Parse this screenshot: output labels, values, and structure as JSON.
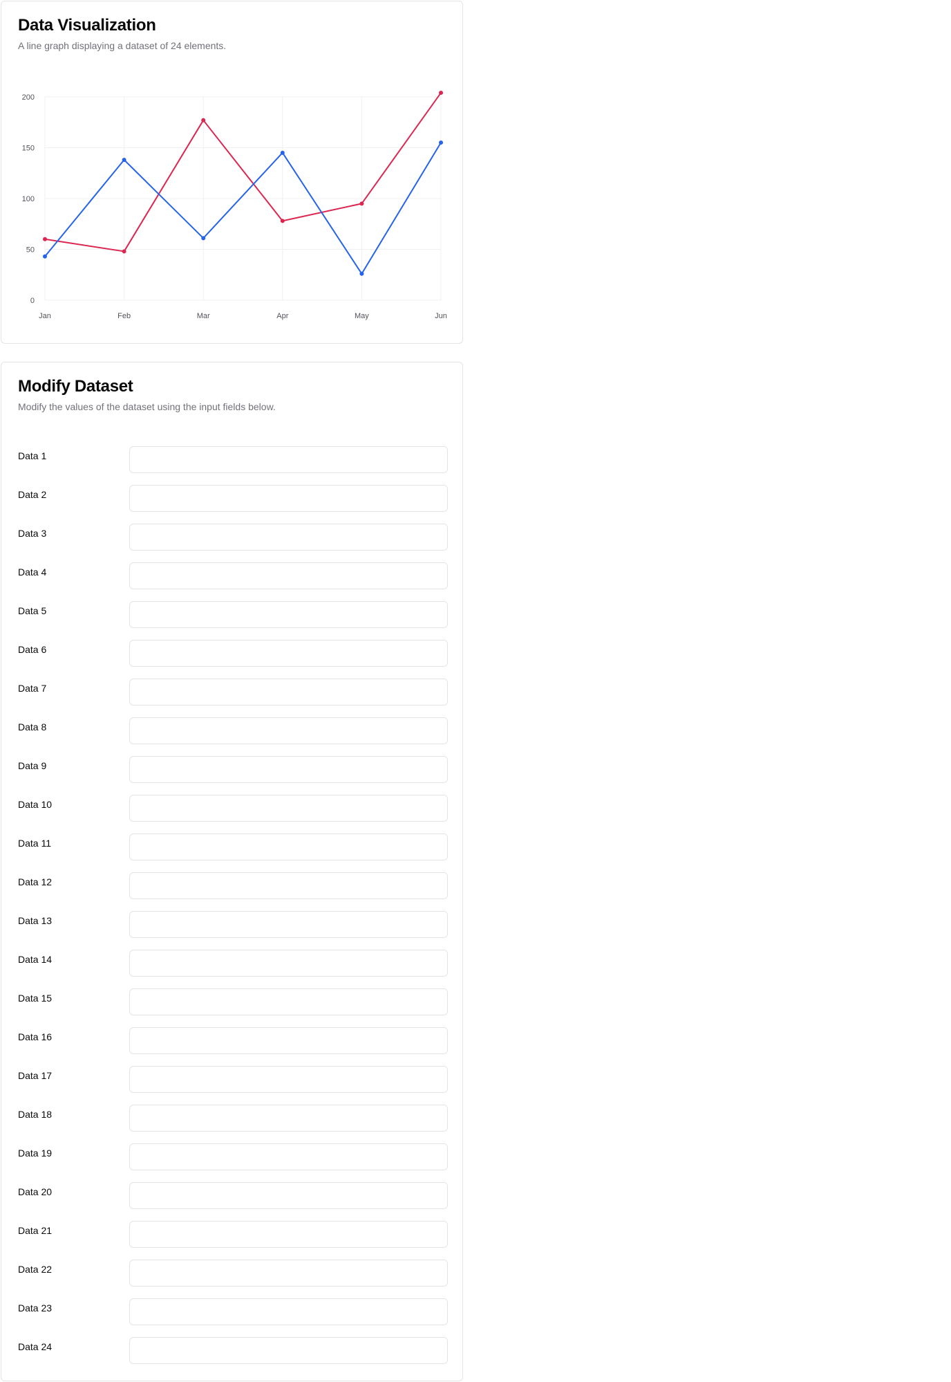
{
  "chart_section": {
    "title": "Data Visualization",
    "description": "A line graph displaying a dataset of 24 elements."
  },
  "form_section": {
    "title": "Modify Dataset",
    "description": "Modify the values of the dataset using the input fields below."
  },
  "fields": [
    {
      "label": "Data 1",
      "value": ""
    },
    {
      "label": "Data 2",
      "value": ""
    },
    {
      "label": "Data 3",
      "value": ""
    },
    {
      "label": "Data 4",
      "value": ""
    },
    {
      "label": "Data 5",
      "value": ""
    },
    {
      "label": "Data 6",
      "value": ""
    },
    {
      "label": "Data 7",
      "value": ""
    },
    {
      "label": "Data 8",
      "value": ""
    },
    {
      "label": "Data 9",
      "value": ""
    },
    {
      "label": "Data 10",
      "value": ""
    },
    {
      "label": "Data 11",
      "value": ""
    },
    {
      "label": "Data 12",
      "value": ""
    },
    {
      "label": "Data 13",
      "value": ""
    },
    {
      "label": "Data 14",
      "value": ""
    },
    {
      "label": "Data 15",
      "value": ""
    },
    {
      "label": "Data 16",
      "value": ""
    },
    {
      "label": "Data 17",
      "value": ""
    },
    {
      "label": "Data 18",
      "value": ""
    },
    {
      "label": "Data 19",
      "value": ""
    },
    {
      "label": "Data 20",
      "value": ""
    },
    {
      "label": "Data 21",
      "value": ""
    },
    {
      "label": "Data 22",
      "value": ""
    },
    {
      "label": "Data 23",
      "value": ""
    },
    {
      "label": "Data 24",
      "value": ""
    }
  ],
  "chart_data": {
    "type": "line",
    "title": "",
    "xlabel": "",
    "ylabel": "",
    "categories": [
      "Jan",
      "Feb",
      "Mar",
      "Apr",
      "May",
      "Jun"
    ],
    "y_ticks": [
      "0",
      "50",
      "100",
      "150",
      "200"
    ],
    "ylim": [
      0,
      200
    ],
    "grid": true,
    "series": [
      {
        "color": "#dc2650",
        "values": [
          60,
          48,
          177,
          78,
          95,
          204
        ]
      },
      {
        "color": "#2563eb",
        "values": [
          43,
          138,
          61,
          145,
          26,
          155
        ]
      }
    ]
  }
}
